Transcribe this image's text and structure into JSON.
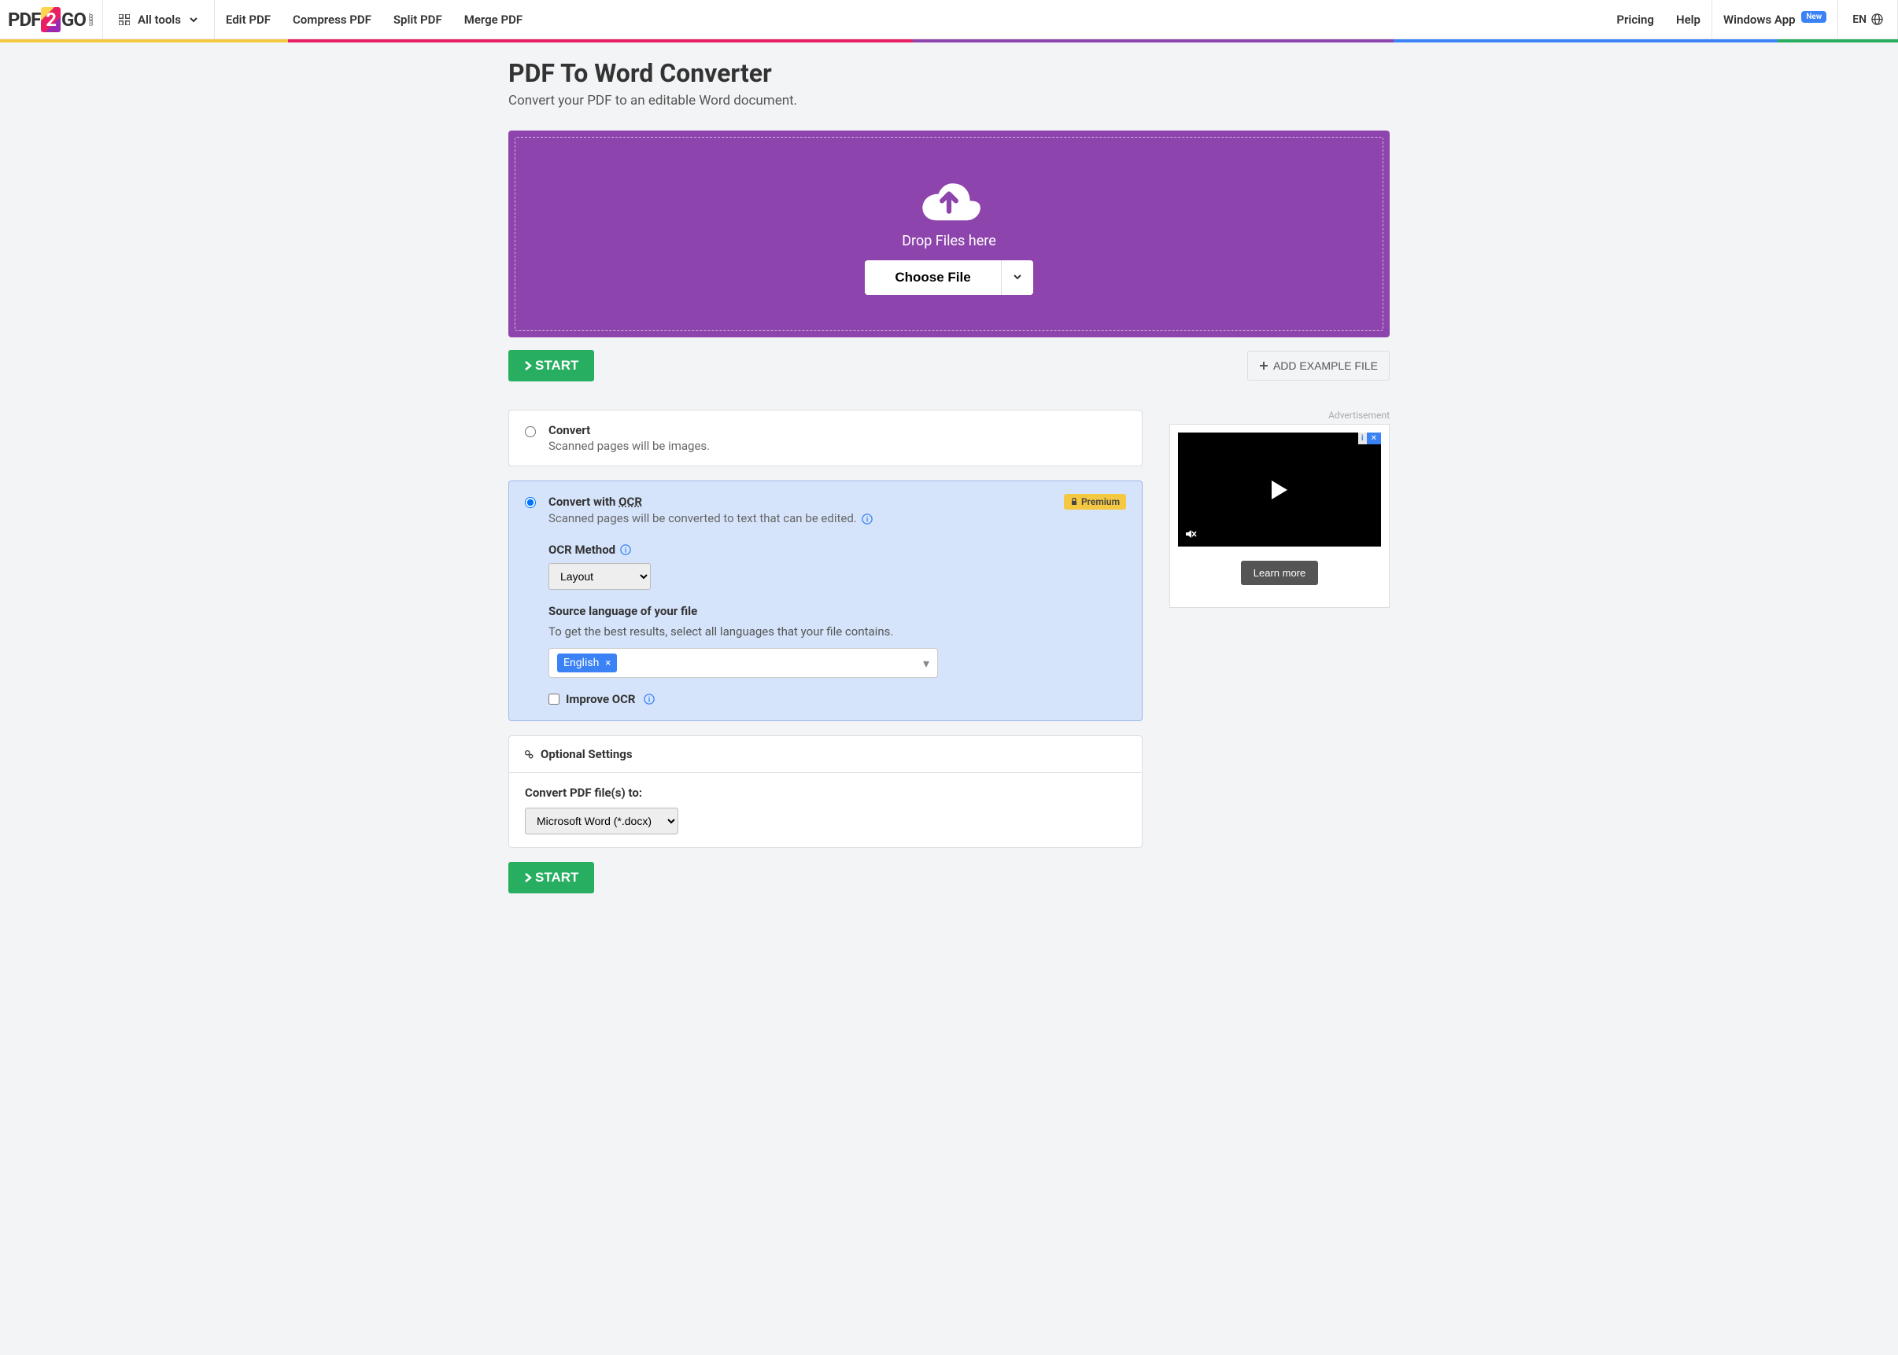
{
  "header": {
    "logo_pdf": "PDF",
    "logo_2": "2",
    "logo_go": "GO",
    "logo_com": ".com",
    "all_tools": "All tools",
    "nav": [
      "Edit PDF",
      "Compress PDF",
      "Split PDF",
      "Merge PDF"
    ],
    "pricing": "Pricing",
    "help": "Help",
    "windows_app": "Windows App",
    "new_badge": "New",
    "lang": "EN"
  },
  "rainbow": [
    "#f5c842",
    "#e91e63",
    "#8e44ad",
    "#3b82f6",
    "#27ae60"
  ],
  "page": {
    "title": "PDF To Word Converter",
    "subtitle": "Convert your PDF to an editable Word document."
  },
  "dropzone": {
    "text": "Drop Files here",
    "choose_file": "Choose File"
  },
  "actions": {
    "start": "START",
    "add_example": "ADD EXAMPLE FILE"
  },
  "options": {
    "convert": {
      "title": "Convert",
      "desc": "Scanned pages will be images."
    },
    "convert_ocr": {
      "title_prefix": "Convert with ",
      "title_ocr": "OCR",
      "desc": "Scanned pages will be converted to text that can be edited.",
      "premium": "Premium",
      "ocr_method_label": "OCR Method",
      "ocr_method_value": "Layout",
      "source_lang_label": "Source language of your file",
      "source_lang_desc": "To get the best results, select all languages that your file contains.",
      "lang_tag": "English",
      "improve_ocr": "Improve OCR"
    }
  },
  "settings": {
    "title": "Optional Settings",
    "convert_to_label": "Convert PDF file(s) to:",
    "convert_to_value": "Microsoft Word (*.docx)"
  },
  "ad": {
    "label": "Advertisement",
    "learn_more": "Learn more"
  }
}
